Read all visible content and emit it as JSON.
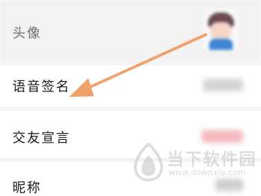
{
  "rows": [
    {
      "label": "头像"
    },
    {
      "label": "语音签名"
    },
    {
      "label": "交友宣言"
    },
    {
      "label": "昵称"
    }
  ],
  "watermark": {
    "title": "当下软件园",
    "url": "www.downxia.com"
  },
  "colors": {
    "arrow": "#f0a06a",
    "watermark": "#bcbcbc",
    "divider": "#f3f3f3"
  },
  "icons": [
    "avatar-image",
    "orange-arrow-annotation",
    "downxia-logo-icon"
  ]
}
